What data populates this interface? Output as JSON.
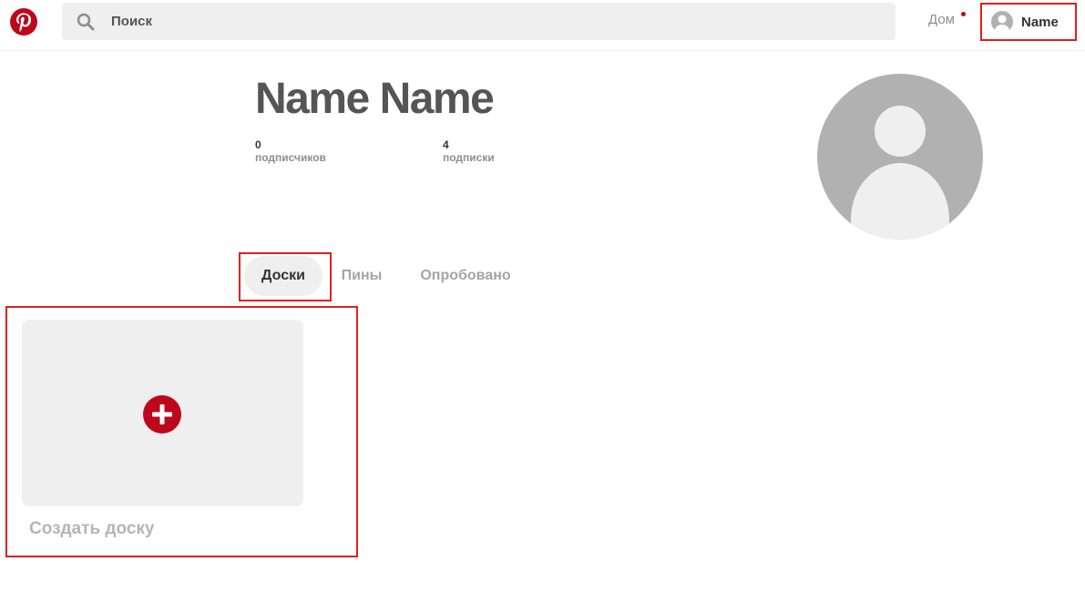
{
  "header": {
    "search": {
      "placeholder": "Поиск",
      "value": ""
    },
    "home_label": "Дом",
    "user_label": "Name"
  },
  "profile": {
    "name": "Name Name",
    "stats": [
      {
        "count": "0",
        "label": "подписчиков"
      },
      {
        "count": "4",
        "label": "подписки"
      }
    ]
  },
  "tabs": [
    {
      "label": "Доски",
      "active": true
    },
    {
      "label": "Пины",
      "active": false
    },
    {
      "label": "Опробовано",
      "active": false
    }
  ],
  "boards": {
    "create_label": "Создать доску"
  },
  "icons": {
    "logo": "pinterest-logo",
    "search": "search-icon",
    "notification": "notification-dot",
    "user_avatar": "user-avatar-icon",
    "profile_avatar": "profile-avatar",
    "create": "plus-icon"
  },
  "colors": {
    "brand": "#bd081c",
    "highlight": "#e0201d",
    "surface": "#efefef",
    "avatar": "#b1b1b1"
  }
}
